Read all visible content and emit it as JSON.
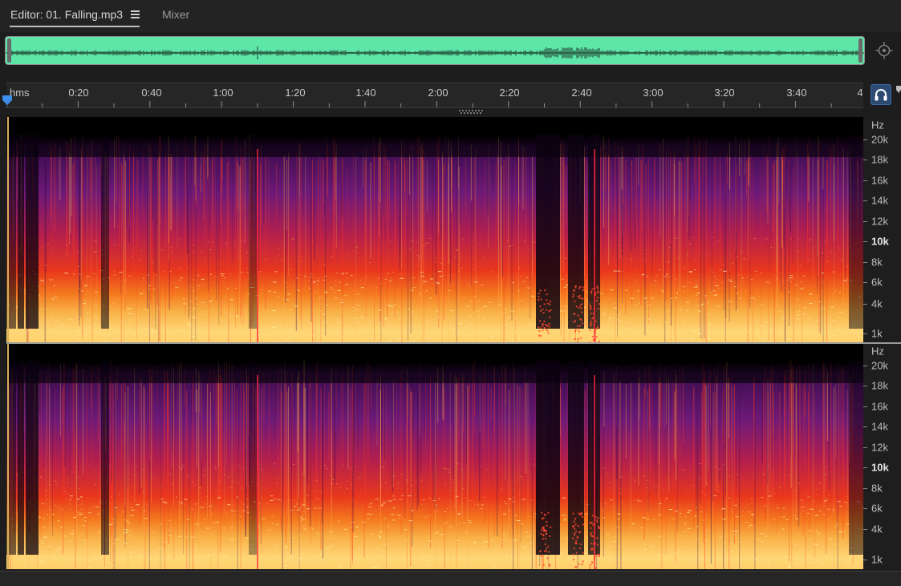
{
  "tabs": {
    "editor_label": "Editor: 01. Falling.mp3",
    "mixer_label": "Mixer"
  },
  "icons": {
    "panel_menu": "hamburger-menu-icon",
    "zoom_navigator": "zoom-crosshair-icon",
    "playhead": "playhead-marker-icon",
    "headphones": "headphones-icon"
  },
  "ruler": {
    "unit_label": "hms",
    "labels": [
      "0:20",
      "0:40",
      "1:00",
      "1:20",
      "1:40",
      "2:00",
      "2:20",
      "2:40",
      "3:00",
      "3:20",
      "3:40",
      "4"
    ]
  },
  "frequency_axis": {
    "unit_label": "Hz",
    "labels": [
      "20k",
      "18k",
      "16k",
      "14k",
      "12k",
      "10k",
      "8k",
      "6k",
      "4k",
      "1k"
    ]
  },
  "colors": {
    "overview_waveform_bg": "#5ee6a8",
    "spectral_low": "#000000",
    "spectral_mid": "#7a1a7a",
    "spectral_high": "#e83a1c",
    "spectral_peak": "#ffd46a",
    "accent": "#2d4a73"
  }
}
